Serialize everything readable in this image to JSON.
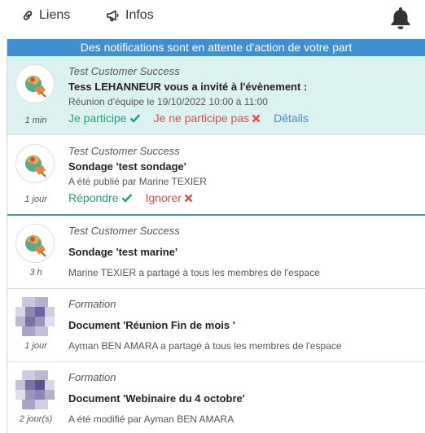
{
  "topbar": {
    "links_label": "Liens",
    "infos_label": "Infos"
  },
  "banner": "Des notifications sont en attente d'action de votre part",
  "notifications": [
    {
      "space": "Test Customer Success",
      "title": "Tess LEHANNEUR vous a invité à l'évènement :",
      "desc": "Réunion d'équipe le 19/10/2022 10:00 à 11:00",
      "time": "1 min",
      "actions": {
        "accept": "Je participe",
        "decline": "Je ne participe pas",
        "details": "Détails"
      }
    },
    {
      "space": "Test Customer Success",
      "title": "Sondage 'test sondage'",
      "desc": "A été publié par Marine TEXIER",
      "time": "1 jour",
      "actions": {
        "reply": "Répondre",
        "ignore": "Ignorer"
      }
    },
    {
      "space": "Test Customer Success",
      "title": "Sondage 'test marine'",
      "desc": "Marine TEXIER a partagé à tous les membres de l'espace",
      "time": "3 h"
    },
    {
      "space": "Formation",
      "title": "Document 'Réunion Fin de mois '",
      "desc": "Ayman BEN AMARA a partagé à tous les membres de l'espace",
      "time": "1 jour"
    },
    {
      "space": "Formation",
      "title": "Document 'Webinaire du 4 octobre'",
      "desc": "A été modifié par Ayman BEN AMARA",
      "time": "2 jour(s)"
    }
  ],
  "colors": {
    "accent": "#3f8fd2",
    "highlight": "#dcf2f1",
    "accept": "#1aa37a",
    "decline": "#e04b4b"
  }
}
